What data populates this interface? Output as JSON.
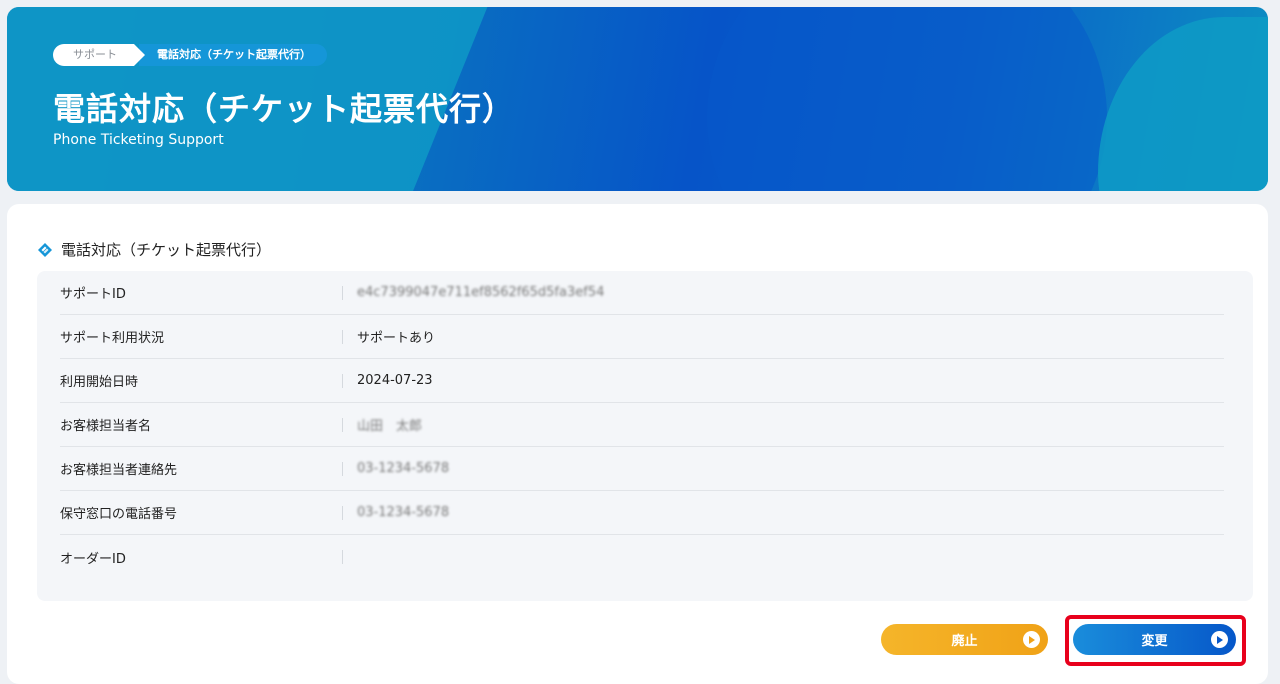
{
  "breadcrumb": {
    "items": [
      "サポート",
      "電話対応（チケット起票代行）"
    ]
  },
  "hero": {
    "title": "電話対応（チケット起票代行）",
    "subtitle": "Phone Ticketing Support"
  },
  "section": {
    "title": "電話対応（チケット起票代行）"
  },
  "details": {
    "rows": [
      {
        "label": "サポートID",
        "value": "e4c7399047e711ef8562f65d5fa3ef54"
      },
      {
        "label": "サポート利用状況",
        "value": "サポートあり"
      },
      {
        "label": "利用開始日時",
        "value": "2024-07-23"
      },
      {
        "label": "お客様担当者名",
        "value": "山田　太郎"
      },
      {
        "label": "お客様担当者連絡先",
        "value": "03-1234-5678"
      },
      {
        "label": "保守窓口の電話番号",
        "value": "03-1234-5678"
      },
      {
        "label": "オーダーID",
        "value": ""
      }
    ]
  },
  "actions": {
    "discard_label": "廃止",
    "change_label": "変更"
  },
  "colors": {
    "accent": "#0657c9",
    "discard": "#f0a217",
    "highlight": "#e8001c"
  }
}
